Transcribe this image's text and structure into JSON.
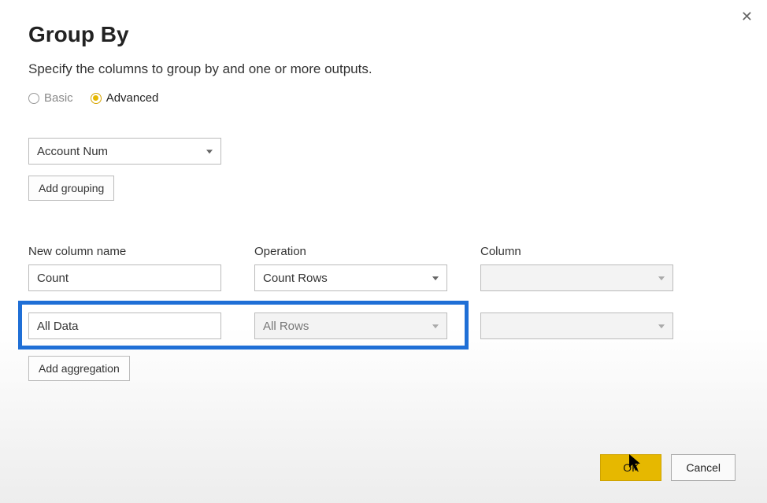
{
  "dialog": {
    "title": "Group By",
    "subtitle": "Specify the columns to group by and one or more outputs."
  },
  "mode": {
    "basic_label": "Basic",
    "advanced_label": "Advanced",
    "selected": "advanced"
  },
  "grouping": {
    "column_value": "Account Num",
    "add_label": "Add grouping"
  },
  "agg_headers": {
    "name": "New column name",
    "operation": "Operation",
    "column": "Column"
  },
  "aggregations": [
    {
      "name": "Count",
      "operation": "Count Rows",
      "column": ""
    },
    {
      "name": "All Data",
      "operation": "All Rows",
      "column": ""
    }
  ],
  "add_aggregation_label": "Add aggregation",
  "footer": {
    "ok": "OK",
    "cancel": "Cancel"
  },
  "colors": {
    "accent": "#e6b800",
    "highlight_border": "#1f6fd6"
  }
}
